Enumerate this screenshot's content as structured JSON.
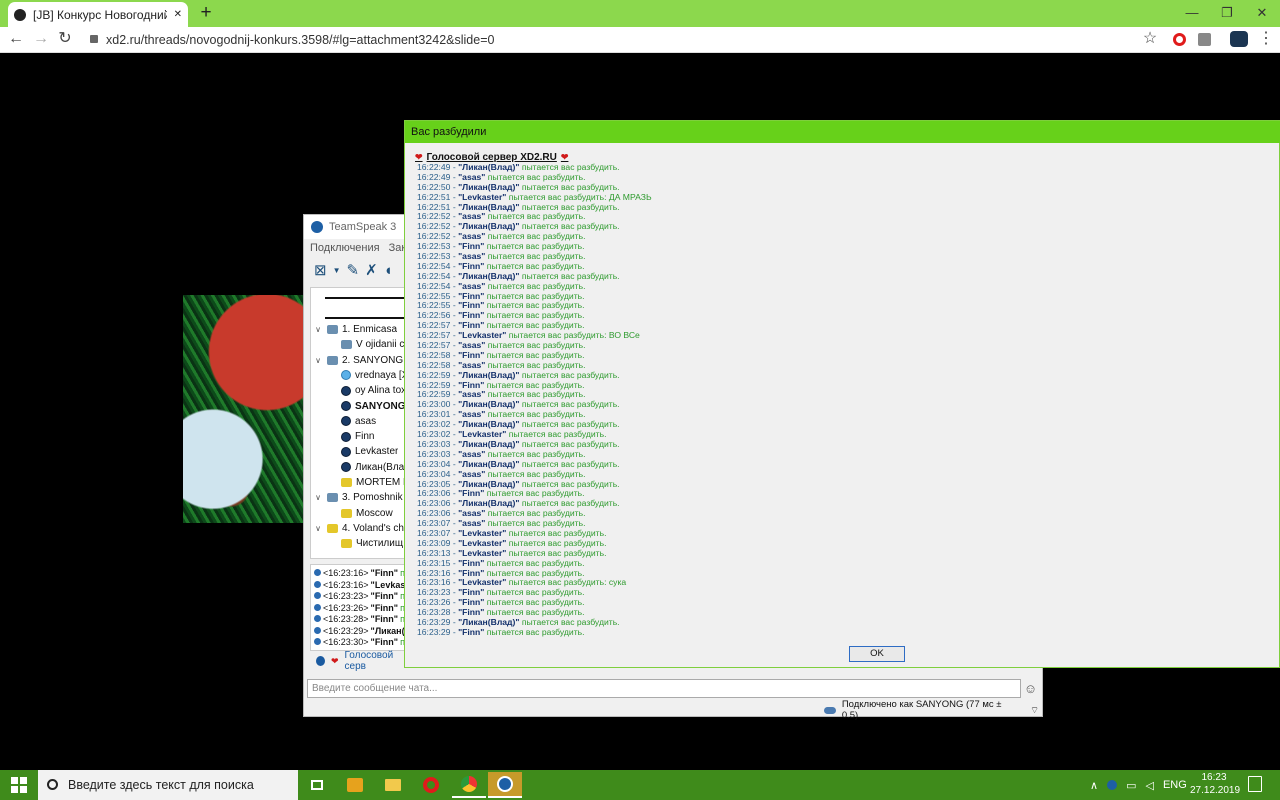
{
  "browser": {
    "tab_title": "[JB] Конкурс Новогодний конку",
    "new_tab": "+",
    "url": "xd2.ru/threads/novogodnij-konkurs.3598/#lg=attachment3242&slide=0",
    "win_minimize": "—",
    "win_restore": "❐",
    "win_close": "✕"
  },
  "teamspeak": {
    "title": "TeamSpeak 3",
    "menu": [
      "Подключения",
      "Закла"
    ],
    "tree": [
      {
        "type": "channel",
        "text": "1. Enmicasa",
        "color": "blue"
      },
      {
        "type": "subchannel",
        "text": "V ojidanii ch",
        "color": "blue"
      },
      {
        "type": "channel",
        "text": "2. SANYONG",
        "color": "blue"
      },
      {
        "type": "user",
        "text": "vrednaya [X",
        "color": "lightblue"
      },
      {
        "type": "user",
        "text": "oy Alina tox",
        "color": "dark"
      },
      {
        "type": "user",
        "text": "SANYONG",
        "color": "dark",
        "bold": true
      },
      {
        "type": "user",
        "text": "asas",
        "color": "dark"
      },
      {
        "type": "user",
        "text": "Finn",
        "color": "dark"
      },
      {
        "type": "user",
        "text": "Levkaster",
        "color": "dark"
      },
      {
        "type": "user",
        "text": "Ликан(Влад",
        "color": "dark"
      },
      {
        "type": "subchannel",
        "text": "MORTEM EL",
        "color": "yellow"
      },
      {
        "type": "channel",
        "text": "3. Pomoshnik",
        "color": "blue"
      },
      {
        "type": "subchannel",
        "text": "Moscow",
        "color": "yellow"
      },
      {
        "type": "channel",
        "text": "4. Voland's cha",
        "color": "yellow"
      },
      {
        "type": "subchannel",
        "text": "Чистилищ",
        "color": "yellow"
      }
    ],
    "log": [
      {
        "time": "<16:23:16>",
        "name": "\"Finn\"",
        "rest": "пы"
      },
      {
        "time": "<16:23:16>",
        "name": "\"Levkas",
        "rest": ""
      },
      {
        "time": "<16:23:23>",
        "name": "\"Finn\"",
        "rest": "пы"
      },
      {
        "time": "<16:23:26>",
        "name": "\"Finn\"",
        "rest": "пы"
      },
      {
        "time": "<16:23:28>",
        "name": "\"Finn\"",
        "rest": "пы"
      },
      {
        "time": "<16:23:29>",
        "name": "\"Ликан(",
        "rest": ""
      },
      {
        "time": "<16:23:30>",
        "name": "\"Finn\"",
        "rest": "пы"
      }
    ],
    "server_tab": "Голосовой серв",
    "chat_placeholder": "Введите сообщение чата...",
    "status": "Подключено как SANYONG (77 мс ± 0.5)"
  },
  "poke": {
    "title": "Вас разбудили",
    "server": "Голосовой сервер XD2.RU",
    "ok": "OK",
    "lines": [
      {
        "t": "16:22:49 - ",
        "n": "\"Ликан(Влад)\"",
        "m": " пытается вас разбудить."
      },
      {
        "t": "16:22:49 - ",
        "n": "\"asas\"",
        "m": " пытается вас разбудить."
      },
      {
        "t": "16:22:50 - ",
        "n": "\"Ликан(Влад)\"",
        "m": " пытается вас разбудить."
      },
      {
        "t": "16:22:51 - ",
        "n": "\"Levkaster\"",
        "m": " пытается вас разбудить: ДА МРАЗЬ"
      },
      {
        "t": "16:22:51 - ",
        "n": "\"Ликан(Влад)\"",
        "m": " пытается вас разбудить."
      },
      {
        "t": "16:22:52 - ",
        "n": "\"asas\"",
        "m": " пытается вас разбудить."
      },
      {
        "t": "16:22:52 - ",
        "n": "\"Ликан(Влад)\"",
        "m": " пытается вас разбудить."
      },
      {
        "t": "16:22:52 - ",
        "n": "\"asas\"",
        "m": " пытается вас разбудить."
      },
      {
        "t": "16:22:53 - ",
        "n": "\"Finn\"",
        "m": " пытается вас разбудить."
      },
      {
        "t": "16:22:53 - ",
        "n": "\"asas\"",
        "m": " пытается вас разбудить."
      },
      {
        "t": "16:22:54 - ",
        "n": "\"Finn\"",
        "m": " пытается вас разбудить."
      },
      {
        "t": "16:22:54 - ",
        "n": "\"Ликан(Влад)\"",
        "m": " пытается вас разбудить."
      },
      {
        "t": "16:22:54 - ",
        "n": "\"asas\"",
        "m": " пытается вас разбудить."
      },
      {
        "t": "16:22:55 - ",
        "n": "\"Finn\"",
        "m": " пытается вас разбудить."
      },
      {
        "t": "16:22:55 - ",
        "n": "\"Finn\"",
        "m": " пытается вас разбудить."
      },
      {
        "t": "16:22:56 - ",
        "n": "\"Finn\"",
        "m": " пытается вас разбудить."
      },
      {
        "t": "16:22:57 - ",
        "n": "\"Finn\"",
        "m": " пытается вас разбудить."
      },
      {
        "t": "16:22:57 - ",
        "n": "\"Levkaster\"",
        "m": " пытается вас разбудить: ВО ВСе"
      },
      {
        "t": "16:22:57 - ",
        "n": "\"asas\"",
        "m": " пытается вас разбудить."
      },
      {
        "t": "16:22:58 - ",
        "n": "\"Finn\"",
        "m": " пытается вас разбудить."
      },
      {
        "t": "16:22:58 - ",
        "n": "\"asas\"",
        "m": " пытается вас разбудить."
      },
      {
        "t": "16:22:59 - ",
        "n": "\"Ликан(Влад)\"",
        "m": " пытается вас разбудить."
      },
      {
        "t": "16:22:59 - ",
        "n": "\"Finn\"",
        "m": " пытается вас разбудить."
      },
      {
        "t": "16:22:59 - ",
        "n": "\"asas\"",
        "m": " пытается вас разбудить."
      },
      {
        "t": "16:23:00 - ",
        "n": "\"Ликан(Влад)\"",
        "m": " пытается вас разбудить."
      },
      {
        "t": "16:23:01 - ",
        "n": "\"asas\"",
        "m": " пытается вас разбудить."
      },
      {
        "t": "16:23:02 - ",
        "n": "\"Ликан(Влад)\"",
        "m": " пытается вас разбудить."
      },
      {
        "t": "16:23:02 - ",
        "n": "\"Levkaster\"",
        "m": " пытается вас разбудить."
      },
      {
        "t": "16:23:03 - ",
        "n": "\"Ликан(Влад)\"",
        "m": " пытается вас разбудить."
      },
      {
        "t": "16:23:03 - ",
        "n": "\"asas\"",
        "m": " пытается вас разбудить."
      },
      {
        "t": "16:23:04 - ",
        "n": "\"Ликан(Влад)\"",
        "m": " пытается вас разбудить."
      },
      {
        "t": "16:23:04 - ",
        "n": "\"asas\"",
        "m": " пытается вас разбудить."
      },
      {
        "t": "16:23:05 - ",
        "n": "\"Ликан(Влад)\"",
        "m": " пытается вас разбудить."
      },
      {
        "t": "16:23:06 - ",
        "n": "\"Finn\"",
        "m": " пытается вас разбудить."
      },
      {
        "t": "16:23:06 - ",
        "n": "\"Ликан(Влад)\"",
        "m": " пытается вас разбудить."
      },
      {
        "t": "16:23:06 - ",
        "n": "\"asas\"",
        "m": " пытается вас разбудить."
      },
      {
        "t": "16:23:07 - ",
        "n": "\"asas\"",
        "m": " пытается вас разбудить."
      },
      {
        "t": "16:23:07 - ",
        "n": "\"Levkaster\"",
        "m": " пытается вас разбудить."
      },
      {
        "t": "16:23:09 - ",
        "n": "\"Levkaster\"",
        "m": " пытается вас разбудить."
      },
      {
        "t": "16:23:13 - ",
        "n": "\"Levkaster\"",
        "m": " пытается вас разбудить."
      },
      {
        "t": "16:23:15 - ",
        "n": "\"Finn\"",
        "m": " пытается вас разбудить."
      },
      {
        "t": "16:23:16 - ",
        "n": "\"Finn\"",
        "m": " пытается вас разбудить."
      },
      {
        "t": "16:23:16 - ",
        "n": "\"Levkaster\"",
        "m": " пытается вас разбудить: сука"
      },
      {
        "t": "16:23:23 - ",
        "n": "\"Finn\"",
        "m": " пытается вас разбудить."
      },
      {
        "t": "16:23:26 - ",
        "n": "\"Finn\"",
        "m": " пытается вас разбудить."
      },
      {
        "t": "16:23:28 - ",
        "n": "\"Finn\"",
        "m": " пытается вас разбудить."
      },
      {
        "t": "16:23:29 - ",
        "n": "\"Ликан(Влад)\"",
        "m": " пытается вас разбудить."
      },
      {
        "t": "16:23:29 - ",
        "n": "\"Finn\"",
        "m": " пытается вас разбудить."
      }
    ]
  },
  "taskbar": {
    "search_placeholder": "Введите здесь текст для поиска",
    "lang": "ENG",
    "time": "16:23",
    "date": "27.12.2019"
  }
}
